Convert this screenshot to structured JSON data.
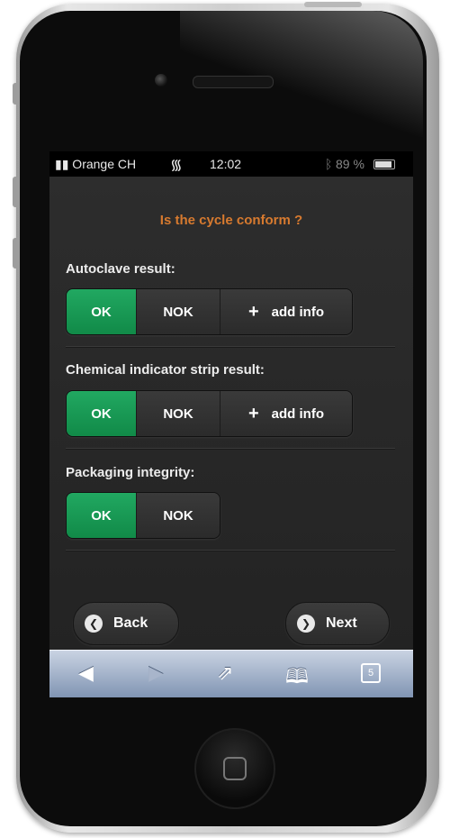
{
  "statusbar": {
    "carrier": "▮▮ Orange CH",
    "time": "12:02",
    "battery": "89 %"
  },
  "header": {
    "title": "Is the cycle conform ?"
  },
  "sections": [
    {
      "label": "Autoclave result:",
      "ok": "OK",
      "nok": "NOK",
      "info": "add info"
    },
    {
      "label": "Chemical indicator strip result:",
      "ok": "OK",
      "nok": "NOK",
      "info": "add info"
    },
    {
      "label": "Packaging integrity:",
      "ok": "OK",
      "nok": "NOK"
    }
  ],
  "nav": {
    "back": "Back",
    "next": "Next"
  },
  "toolbar": {
    "back_icon": "◀",
    "forward_icon": "▶",
    "share_icon": "⇗",
    "bookmarks_icon": "🕮",
    "tabs_count": "5"
  },
  "colors": {
    "accent": "#d77a2f",
    "ok_green": "#17994f",
    "screen_bg": "#242424"
  }
}
